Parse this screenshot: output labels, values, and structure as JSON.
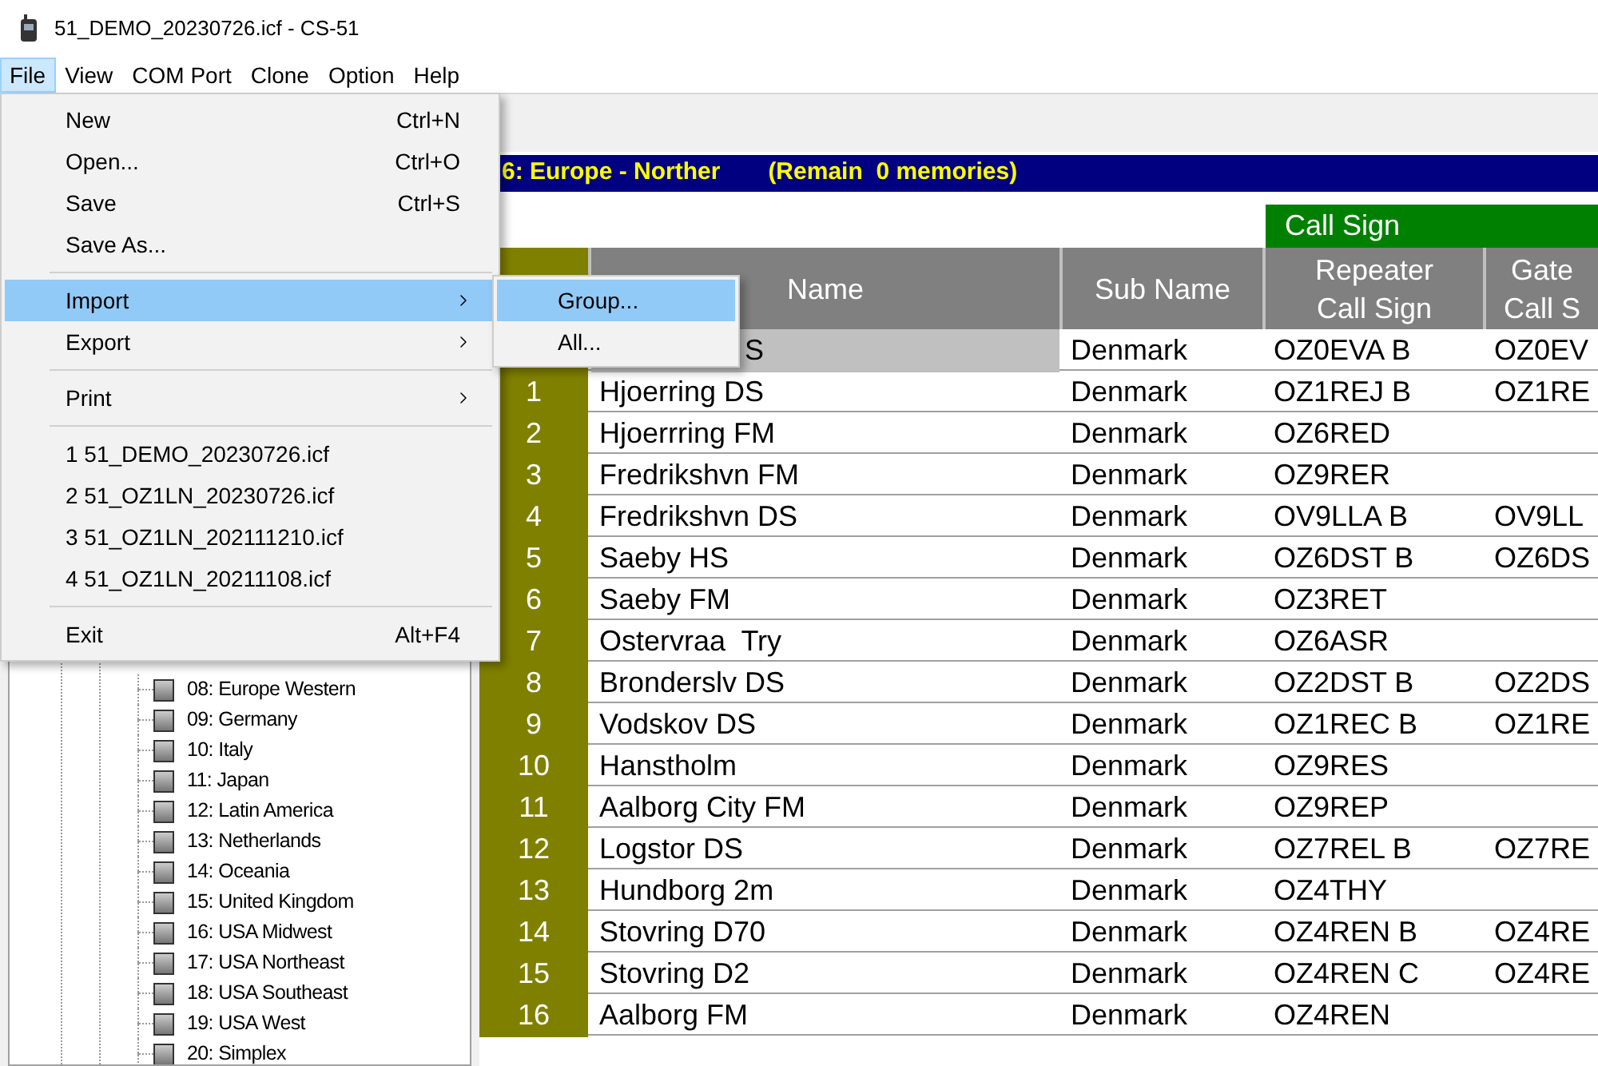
{
  "window": {
    "title": "51_DEMO_20230726.icf - CS-51"
  },
  "menu_bar": [
    {
      "label": "File",
      "selected": true
    },
    {
      "label": "View",
      "selected": false
    },
    {
      "label": "COM Port",
      "selected": false
    },
    {
      "label": "Clone",
      "selected": false
    },
    {
      "label": "Option",
      "selected": false
    },
    {
      "label": "Help",
      "selected": false
    }
  ],
  "file_menu": [
    {
      "kind": "item",
      "label": "New",
      "shortcut": "Ctrl+N",
      "highlighted": false
    },
    {
      "kind": "item",
      "label": "Open...",
      "shortcut": "Ctrl+O",
      "highlighted": false
    },
    {
      "kind": "item",
      "label": "Save",
      "shortcut": "Ctrl+S",
      "highlighted": false
    },
    {
      "kind": "item",
      "label": "Save As...",
      "highlighted": false
    },
    {
      "kind": "separator"
    },
    {
      "kind": "submenu",
      "label": "Import",
      "highlighted": true
    },
    {
      "kind": "submenu",
      "label": "Export",
      "highlighted": false
    },
    {
      "kind": "separator"
    },
    {
      "kind": "submenu",
      "label": "Print",
      "highlighted": false
    },
    {
      "kind": "separator"
    },
    {
      "kind": "item",
      "label": "1 51_DEMO_20230726.icf",
      "highlighted": false
    },
    {
      "kind": "item",
      "label": "2 51_OZ1LN_20230726.icf",
      "highlighted": false
    },
    {
      "kind": "item",
      "label": "3 51_OZ1LN_202111210.icf",
      "highlighted": false
    },
    {
      "kind": "item",
      "label": "4 51_OZ1LN_20211108.icf",
      "highlighted": false
    },
    {
      "kind": "separator"
    },
    {
      "kind": "item",
      "label": "Exit",
      "shortcut": "Alt+F4",
      "highlighted": false
    }
  ],
  "import_submenu": [
    {
      "label": "Group...",
      "highlighted": true
    },
    {
      "label": "All...",
      "highlighted": false
    }
  ],
  "tree": {
    "items": [
      "08: Europe Western",
      "09: Germany",
      "10: Italy",
      "11: Japan",
      "12: Latin America",
      "13: Netherlands",
      "14: Oceania",
      "15: United Kingdom",
      "16: USA Midwest",
      "17: USA Northeast",
      "18: USA Southeast",
      "19: USA West",
      "20: Simplex"
    ]
  },
  "group_bar": {
    "title": "6: Europe - Norther",
    "remain": "(Remain  0 memories)"
  },
  "table": {
    "group_header": "Call Sign",
    "columns": [
      [
        "Name"
      ],
      [
        "Sub Name"
      ],
      [
        "Repeater",
        "Call Sign"
      ],
      [
        "Gate",
        "Call S"
      ]
    ],
    "rows": [
      {
        "number": "",
        "name": "S",
        "sub_name": "Denmark",
        "repeater": "OZ0EVA B",
        "gateway": "OZ0EV",
        "selected": true,
        "partly_hidden": true
      },
      {
        "number": "1",
        "name": "Hjoerring DS",
        "sub_name": "Denmark",
        "repeater": "OZ1REJ B",
        "gateway": "OZ1RE",
        "selected": false
      },
      {
        "number": "2",
        "name": "Hjoerrring FM",
        "sub_name": "Denmark",
        "repeater": "OZ6RED",
        "gateway": "",
        "selected": false
      },
      {
        "number": "3",
        "name": "Fredrikshvn FM",
        "sub_name": "Denmark",
        "repeater": "OZ9RER",
        "gateway": "",
        "selected": false
      },
      {
        "number": "4",
        "name": "Fredrikshvn DS",
        "sub_name": "Denmark",
        "repeater": "OV9LLA B",
        "gateway": "OV9LL",
        "selected": false
      },
      {
        "number": "5",
        "name": "Saeby HS",
        "sub_name": "Denmark",
        "repeater": "OZ6DST B",
        "gateway": "OZ6DS",
        "selected": false
      },
      {
        "number": "6",
        "name": "Saeby FM",
        "sub_name": "Denmark",
        "repeater": "OZ3RET",
        "gateway": "",
        "selected": false
      },
      {
        "number": "7",
        "name": "Ostervraa  Try",
        "sub_name": "Denmark",
        "repeater": "OZ6ASR",
        "gateway": "",
        "selected": false
      },
      {
        "number": "8",
        "name": "Bronderslv DS",
        "sub_name": "Denmark",
        "repeater": "OZ2DST B",
        "gateway": "OZ2DS",
        "selected": false
      },
      {
        "number": "9",
        "name": "Vodskov DS",
        "sub_name": "Denmark",
        "repeater": "OZ1REC B",
        "gateway": "OZ1RE",
        "selected": false
      },
      {
        "number": "10",
        "name": "Hanstholm",
        "sub_name": "Denmark",
        "repeater": "OZ9RES",
        "gateway": "",
        "selected": false
      },
      {
        "number": "11",
        "name": "Aalborg City FM",
        "sub_name": "Denmark",
        "repeater": "OZ9REP",
        "gateway": "",
        "selected": false
      },
      {
        "number": "12",
        "name": "Logstor DS",
        "sub_name": "Denmark",
        "repeater": "OZ7REL B",
        "gateway": "OZ7RE",
        "selected": false
      },
      {
        "number": "13",
        "name": "Hundborg 2m",
        "sub_name": "Denmark",
        "repeater": "OZ4THY",
        "gateway": "",
        "selected": false
      },
      {
        "number": "14",
        "name": "Stovring D70",
        "sub_name": "Denmark",
        "repeater": "OZ4REN B",
        "gateway": "OZ4RE",
        "selected": false
      },
      {
        "number": "15",
        "name": "Stovring D2",
        "sub_name": "Denmark",
        "repeater": "OZ4REN C",
        "gateway": "OZ4RE",
        "selected": false
      },
      {
        "number": "16",
        "name": "Aalborg FM",
        "sub_name": "Denmark",
        "repeater": "OZ4REN",
        "gateway": "",
        "selected": false
      }
    ]
  }
}
